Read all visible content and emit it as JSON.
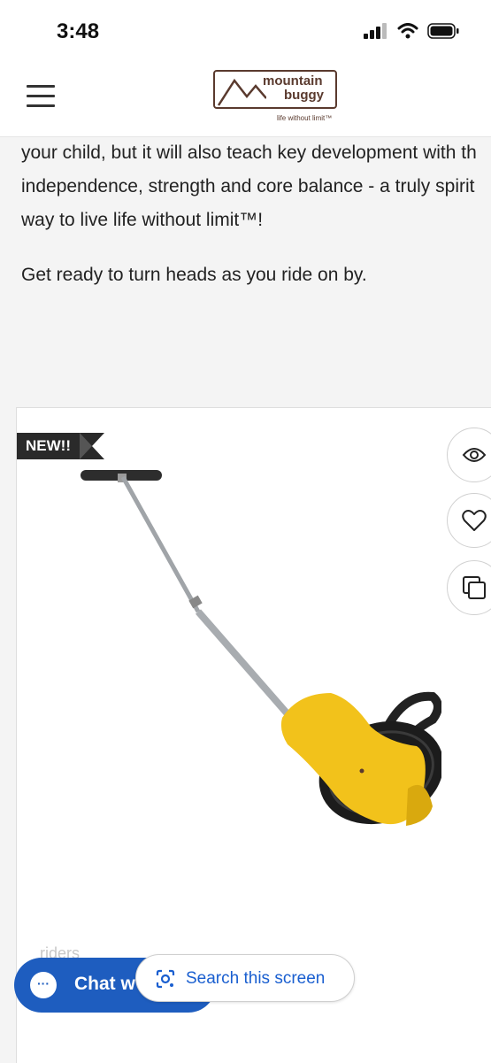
{
  "status_bar": {
    "time": "3:48"
  },
  "header": {
    "logo_word1": "mountain",
    "logo_word2": "buggy",
    "logo_registered": "®",
    "logo_tagline": "life without limit™"
  },
  "article": {
    "line1": "your child, but it will also teach key development with th",
    "line2": "independence, strength and core balance - a truly spirit",
    "line3": "way to live life without limit™!",
    "line4": "Get ready to turn heads as you ride on by."
  },
  "product": {
    "badge": "NEW!!",
    "riders_text": "riders"
  },
  "chat": {
    "label": "Chat w",
    "icon_glyph": "···"
  },
  "search_screen": {
    "label": "Search this screen"
  },
  "colors": {
    "brand_brown": "#5a3a2e",
    "chat_blue": "#1e5dbf",
    "search_blue": "#1a5fd0",
    "product_yellow": "#f2c21b"
  }
}
